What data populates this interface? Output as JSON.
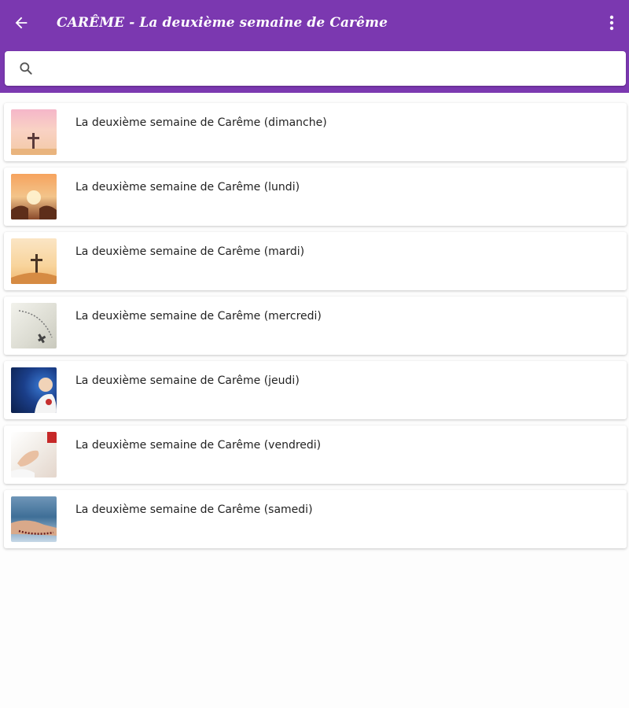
{
  "header": {
    "title": "CARÊME - La deuxième semaine de Carême",
    "back_icon": "arrow-left-icon",
    "menu_icon": "more-vert-icon",
    "color": "#7b38b0"
  },
  "search": {
    "icon": "search-icon",
    "value": "",
    "placeholder": ""
  },
  "items": [
    {
      "label": "La deuxième semaine de Carême (dimanche)",
      "thumb": "cross-sunset-image"
    },
    {
      "label": "La deuxième semaine de Carême (lundi)",
      "thumb": "hands-sunrise-image"
    },
    {
      "label": "La deuxième semaine de Carême (mardi)",
      "thumb": "cross-hill-image"
    },
    {
      "label": "La deuxième semaine de Carême (mercredi)",
      "thumb": "rosary-image"
    },
    {
      "label": "La deuxième semaine de Carême (jeudi)",
      "thumb": "pope-image"
    },
    {
      "label": "La deuxième semaine de Carême (vendredi)",
      "thumb": "praying-hands-image"
    },
    {
      "label": "La deuxième semaine de Carême (samedi)",
      "thumb": "rosary-hands-image"
    }
  ]
}
